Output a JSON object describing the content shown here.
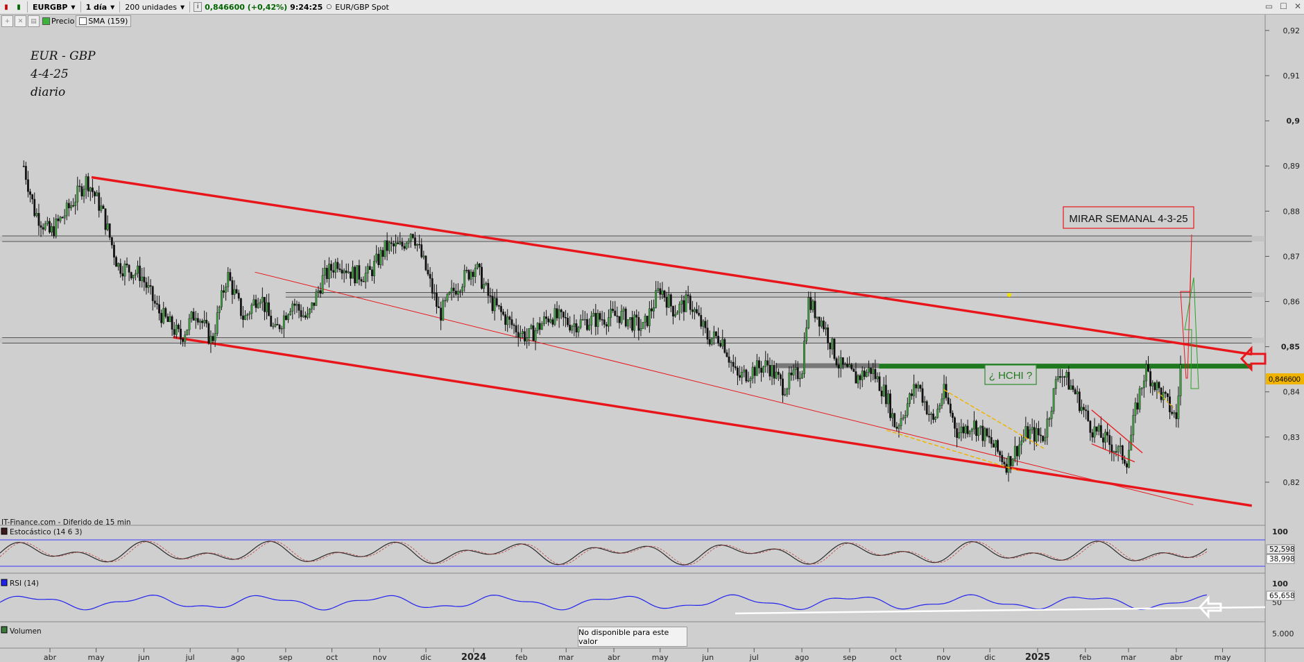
{
  "toolbar": {
    "symbol": "EURGBP",
    "interval": "1 día",
    "units": "200 unidades",
    "price_change": "0,846600 (+0,42%)",
    "time": "9:24:25",
    "instrument": "EUR/GBP Spot",
    "win_min": "▭",
    "win_max": "☐",
    "win_close": "✕"
  },
  "legend": {
    "price": "Precio",
    "sma": "SMA (159)"
  },
  "annotations": {
    "title_lines": [
      "EUR - GBP",
      "4-4-25",
      "diario"
    ],
    "mirar": "MIRAR SEMANAL 4-3-25",
    "hchi": "¿ HCHI ?",
    "source": "IT-Finance.com - Diferido de 15 min",
    "tooltip": "No disponible para este valor"
  },
  "colors": {
    "background": "#cfcfcf",
    "channel": "#e8161b",
    "neckline": "#1f7a1f",
    "rsi": "#2222ee",
    "stoch": "#2a2a2a",
    "last_price_bg": "#f0b400"
  },
  "chart_data": [
    {
      "type": "candlestick",
      "title": "EUR - GBP",
      "ylim": [
        0.81,
        0.925
      ],
      "yticks": [
        {
          "value": 0.92,
          "label": "0,92"
        },
        {
          "value": 0.91,
          "label": "0,91"
        },
        {
          "value": 0.9,
          "label": "0,9"
        },
        {
          "value": 0.89,
          "label": "0,89"
        },
        {
          "value": 0.88,
          "label": "0,88"
        },
        {
          "value": 0.87,
          "label": "0,87"
        },
        {
          "value": 0.86,
          "label": "0,86"
        },
        {
          "value": 0.85,
          "label": "0,85"
        },
        {
          "value": 0.84,
          "label": "0,84"
        },
        {
          "value": 0.83,
          "label": "0,83"
        },
        {
          "value": 0.82,
          "label": "0,82"
        }
      ],
      "last_price": {
        "value": 0.8466,
        "label": "0,846600"
      },
      "x_months": [
        "abr",
        "may",
        "jun",
        "jul",
        "ago",
        "sep",
        "oct",
        "nov",
        "dic",
        "2024",
        "feb",
        "mar",
        "abr",
        "may",
        "jun",
        "jul",
        "ago",
        "sep",
        "oct",
        "nov",
        "dic",
        "2025",
        "feb",
        "mar",
        "abr",
        "may"
      ],
      "x_month_dates": [
        "2023-04",
        "2023-05",
        "2023-06",
        "2023-07",
        "2023-08",
        "2023-09",
        "2023-10",
        "2023-11",
        "2023-12",
        "2024-01",
        "2024-02",
        "2024-03",
        "2024-04",
        "2024-05",
        "2024-06",
        "2024-07",
        "2024-08",
        "2024-09",
        "2024-10",
        "2024-11",
        "2024-12",
        "2025-01",
        "2025-02",
        "2025-03",
        "2025-04",
        "2025-05"
      ],
      "close_path": [
        [
          "2023-03-15",
          0.89
        ],
        [
          "2023-03-22",
          0.88
        ],
        [
          "2023-04-01",
          0.875
        ],
        [
          "2023-04-12",
          0.88
        ],
        [
          "2023-04-25",
          0.887
        ],
        [
          "2023-05-05",
          0.88
        ],
        [
          "2023-05-15",
          0.868
        ],
        [
          "2023-05-30",
          0.866
        ],
        [
          "2023-06-10",
          0.858
        ],
        [
          "2023-06-25",
          0.852
        ],
        [
          "2023-07-05",
          0.858
        ],
        [
          "2023-07-15",
          0.851
        ],
        [
          "2023-07-25",
          0.866
        ],
        [
          "2023-08-05",
          0.856
        ],
        [
          "2023-08-15",
          0.862
        ],
        [
          "2023-08-25",
          0.853
        ],
        [
          "2023-09-05",
          0.86
        ],
        [
          "2023-09-15",
          0.856
        ],
        [
          "2023-09-25",
          0.865
        ],
        [
          "2023-10-05",
          0.869
        ],
        [
          "2023-10-15",
          0.866
        ],
        [
          "2023-10-25",
          0.866
        ],
        [
          "2023-11-05",
          0.872
        ],
        [
          "2023-11-15",
          0.872
        ],
        [
          "2023-11-22",
          0.876
        ],
        [
          "2023-12-01",
          0.867
        ],
        [
          "2023-12-10",
          0.857
        ],
        [
          "2023-12-20",
          0.863
        ],
        [
          "2024-01-02",
          0.868
        ],
        [
          "2024-01-12",
          0.86
        ],
        [
          "2024-01-25",
          0.855
        ],
        [
          "2024-02-05",
          0.852
        ],
        [
          "2024-02-20",
          0.857
        ],
        [
          "2024-03-05",
          0.855
        ],
        [
          "2024-03-20",
          0.856
        ],
        [
          "2024-04-05",
          0.857
        ],
        [
          "2024-04-20",
          0.854
        ],
        [
          "2024-05-01",
          0.863
        ],
        [
          "2024-05-10",
          0.858
        ],
        [
          "2024-05-20",
          0.86
        ],
        [
          "2024-06-01",
          0.852
        ],
        [
          "2024-06-10",
          0.852
        ],
        [
          "2024-06-20",
          0.843
        ],
        [
          "2024-07-01",
          0.845
        ],
        [
          "2024-07-10",
          0.846
        ],
        [
          "2024-07-20",
          0.841
        ],
        [
          "2024-08-01",
          0.845
        ],
        [
          "2024-08-05",
          0.86
        ],
        [
          "2024-08-15",
          0.855
        ],
        [
          "2024-08-25",
          0.846
        ],
        [
          "2024-09-05",
          0.843
        ],
        [
          "2024-09-15",
          0.845
        ],
        [
          "2024-09-25",
          0.839
        ],
        [
          "2024-10-01",
          0.832
        ],
        [
          "2024-10-15",
          0.842
        ],
        [
          "2024-10-25",
          0.833
        ],
        [
          "2024-11-01",
          0.84
        ],
        [
          "2024-11-10",
          0.831
        ],
        [
          "2024-11-20",
          0.833
        ],
        [
          "2024-12-01",
          0.829
        ],
        [
          "2024-12-12",
          0.824
        ],
        [
          "2024-12-25",
          0.831
        ],
        [
          "2025-01-05",
          0.83
        ],
        [
          "2025-01-15",
          0.845
        ],
        [
          "2025-01-25",
          0.84
        ],
        [
          "2025-02-05",
          0.832
        ],
        [
          "2025-02-15",
          0.829
        ],
        [
          "2025-02-28",
          0.825
        ],
        [
          "2025-03-05",
          0.835
        ],
        [
          "2025-03-12",
          0.845
        ],
        [
          "2025-03-25",
          0.838
        ],
        [
          "2025-04-01",
          0.834
        ],
        [
          "2025-04-04",
          0.8466
        ]
      ],
      "lines": [
        {
          "name": "upper-channel",
          "from": [
            "2023-04-28",
            0.8875
          ],
          "to": [
            "2025-05-20",
            0.8483
          ]
        },
        {
          "name": "lower-channel",
          "from": [
            "2023-06-20",
            0.8521
          ],
          "to": [
            "2025-05-20",
            0.8148
          ]
        },
        {
          "name": "inner-support",
          "from": [
            "2023-08-12",
            0.8665
          ],
          "to": [
            "2025-04-12",
            0.815
          ]
        },
        {
          "name": "neckline",
          "from": [
            "2024-09-20",
            0.8457
          ],
          "to": [
            "2025-05-20",
            0.8457
          ]
        },
        {
          "name": "resistance",
          "from": [
            "2023-03-01",
            0.8745
          ],
          "to": [
            "2025-05-20",
            0.8745
          ]
        },
        {
          "name": "resistance",
          "from": [
            "2023-03-01",
            0.8733
          ],
          "to": [
            "2025-05-20",
            0.8733
          ]
        },
        {
          "name": "resistance",
          "from": [
            "2023-09-01",
            0.862
          ],
          "to": [
            "2025-05-20",
            0.862
          ]
        },
        {
          "name": "resistance",
          "from": [
            "2023-09-01",
            0.861
          ],
          "to": [
            "2025-05-20",
            0.861
          ]
        },
        {
          "name": "support",
          "from": [
            "2023-03-01",
            0.852
          ],
          "to": [
            "2025-05-20",
            0.852
          ]
        },
        {
          "name": "support",
          "from": [
            "2023-03-01",
            0.8508
          ],
          "to": [
            "2025-05-20",
            0.8508
          ]
        },
        {
          "name": "old-neckline",
          "from": [
            "2024-07-15",
            0.8458
          ],
          "to": [
            "2024-09-20",
            0.8458
          ]
        }
      ]
    },
    {
      "type": "line",
      "name": "Estocástico (14 6 3)",
      "ylim": [
        0,
        100
      ],
      "ytick": "100",
      "last_values": [
        "52,598",
        "38,998"
      ]
    },
    {
      "type": "line",
      "name": "RSI (14)",
      "ylim": [
        0,
        100
      ],
      "yticks": [
        "100",
        "50"
      ],
      "last_value": "65,658"
    },
    {
      "type": "bar",
      "name": "Volumen",
      "ytick": "5.000"
    }
  ]
}
